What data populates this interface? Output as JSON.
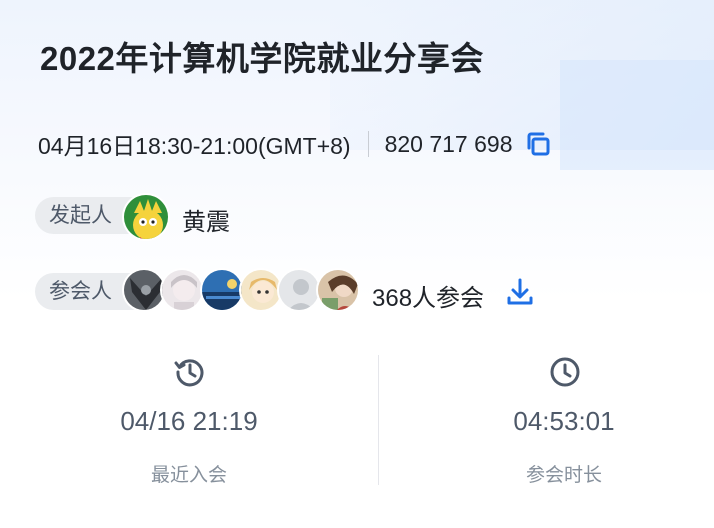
{
  "meeting": {
    "title": "2022年计算机学院就业分享会",
    "datetime": "04月16日18:30-21:00(GMT+8)",
    "meeting_id": "820 717 698"
  },
  "host": {
    "label": "发起人",
    "name": "黄震"
  },
  "attendees": {
    "label": "参会人",
    "count_text": "368人参会",
    "avatars": [
      "avatar-1",
      "avatar-2",
      "avatar-3",
      "avatar-4",
      "avatar-5",
      "avatar-6"
    ]
  },
  "stats": {
    "last_join": {
      "value": "04/16 21:19",
      "label": "最近入会",
      "icon": "history-icon"
    },
    "duration": {
      "value": "04:53:01",
      "label": "参会时长",
      "icon": "clock-icon"
    }
  },
  "colors": {
    "accent": "#1f6fe5",
    "title": "#1f2329",
    "muted": "#86909c",
    "pill_bg": "#eaecef"
  }
}
